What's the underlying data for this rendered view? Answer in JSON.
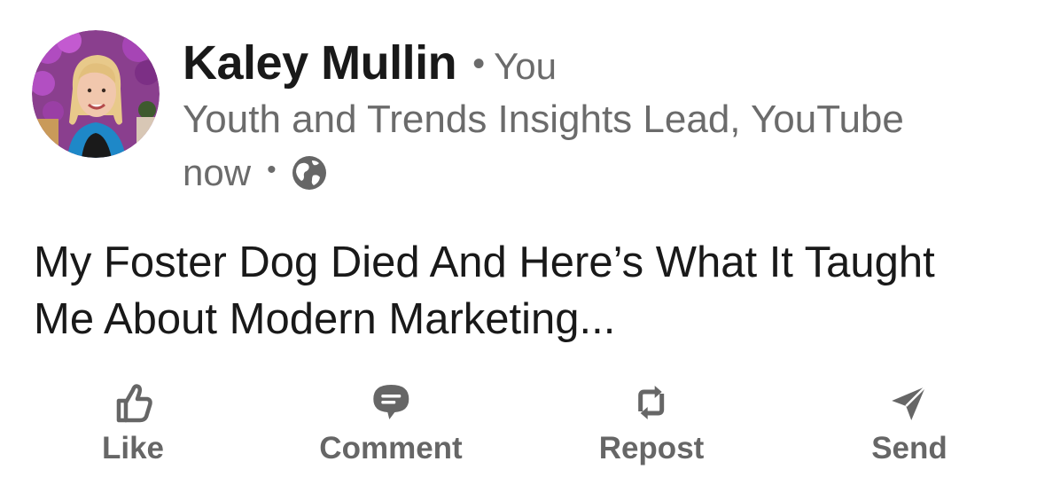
{
  "author": {
    "name": "Kaley Mullin",
    "separator": "•",
    "relation": "You",
    "headline": "Youth and Trends Insights Lead, YouTube",
    "avatar_icon": "profile-photo"
  },
  "meta": {
    "time": "now",
    "separator": "•",
    "visibility_icon": "globe-icon"
  },
  "post": {
    "text": "My Foster Dog Died And Here’s What It Taught Me About Modern Marketing..."
  },
  "actions": [
    {
      "label": "Like",
      "icon": "thumbs-up-icon"
    },
    {
      "label": "Comment",
      "icon": "comment-icon"
    },
    {
      "label": "Repost",
      "icon": "repost-icon"
    },
    {
      "label": "Send",
      "icon": "send-icon"
    }
  ],
  "colors": {
    "primary_text": "#191919",
    "secondary_text": "#6b6b6b",
    "action_text": "#666666"
  }
}
